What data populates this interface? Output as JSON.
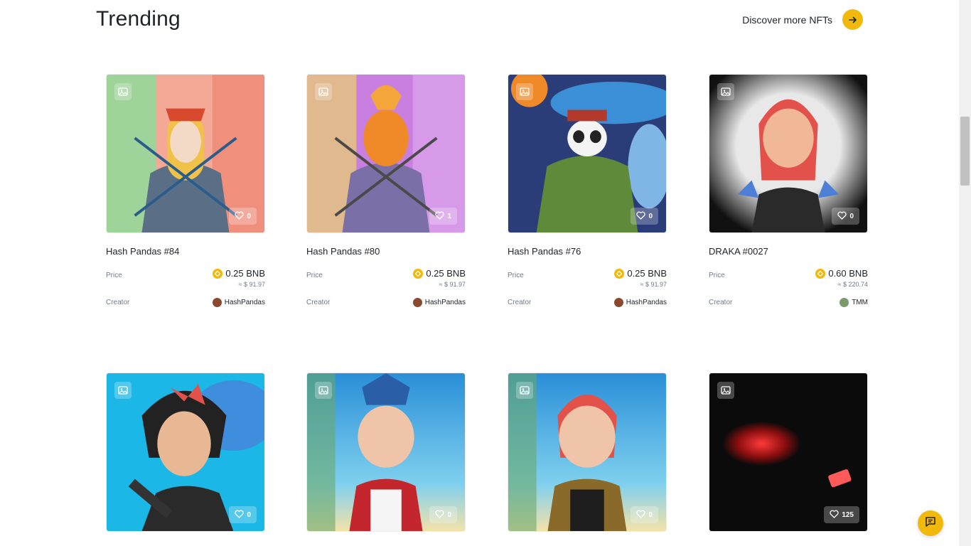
{
  "header": {
    "title": "Trending",
    "discover_label": "Discover more NFTs"
  },
  "labels": {
    "price": "Price",
    "creator": "Creator"
  },
  "colors": {
    "accent": "#f0b90b",
    "text": "#1e2329",
    "muted": "#707a8a"
  },
  "icons": {
    "media_type": "image-icon",
    "like": "heart-icon",
    "currency": "bnb-coin-icon",
    "discover": "arrow-right-icon",
    "chat": "chat-icon"
  },
  "cards": [
    {
      "name": "Hash Pandas #84",
      "likes": "0",
      "price": "0.25 BNB",
      "usd": "≈ $ 91.97",
      "creator": "HashPandas"
    },
    {
      "name": "Hash Pandas #80",
      "likes": "1",
      "price": "0.25 BNB",
      "usd": "≈ $ 91.97",
      "creator": "HashPandas"
    },
    {
      "name": "Hash Pandas #76",
      "likes": "0",
      "price": "0.25 BNB",
      "usd": "≈ $ 91.97",
      "creator": "HashPandas"
    },
    {
      "name": "DRAKA #0027",
      "likes": "0",
      "price": "0.60 BNB",
      "usd": "≈ $ 220.74",
      "creator": "TMM"
    },
    {
      "likes": "0"
    },
    {
      "likes": "0"
    },
    {
      "likes": "0"
    },
    {
      "likes": "125"
    }
  ]
}
